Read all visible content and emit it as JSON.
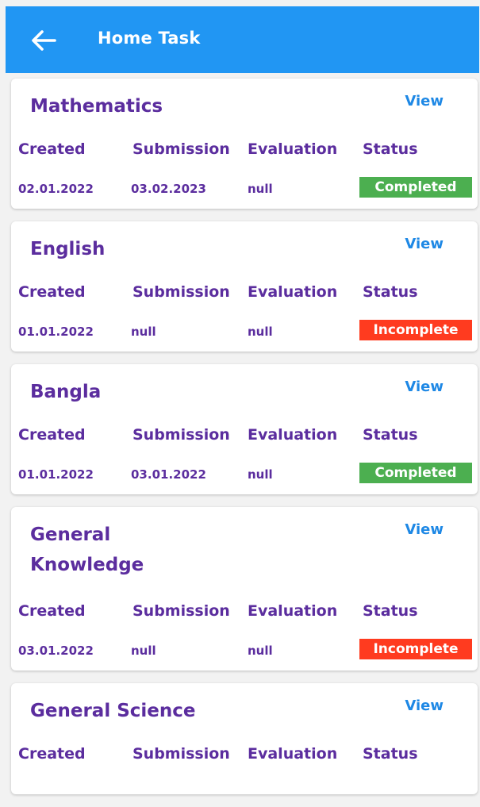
{
  "appbar": {
    "title": "Home Task",
    "back_icon": "arrow-left-icon"
  },
  "columns": {
    "created": "Created",
    "submission": "Submission",
    "evaluation": "Evaluation",
    "status": "Status"
  },
  "view_label": "View",
  "colors": {
    "appbar": "#2196f3",
    "subject": "#5b2d9e",
    "link": "#1e88e5",
    "completed": "#4caf50",
    "incomplete": "#ff3b1f"
  },
  "tasks": [
    {
      "subject": "Mathematics",
      "created": "02.01.2022",
      "submission": "03.02.2023",
      "evaluation": "null",
      "status": "Completed"
    },
    {
      "subject": "English",
      "created": "01.01.2022",
      "submission": "null",
      "evaluation": "null",
      "status": "Incomplete"
    },
    {
      "subject": "Bangla",
      "created": "01.01.2022",
      "submission": "03.01.2022",
      "evaluation": "null",
      "status": "Completed"
    },
    {
      "subject": "General Knowledge",
      "created": "03.01.2022",
      "submission": "null",
      "evaluation": "null",
      "status": "Incomplete"
    },
    {
      "subject": "General Science"
    }
  ]
}
